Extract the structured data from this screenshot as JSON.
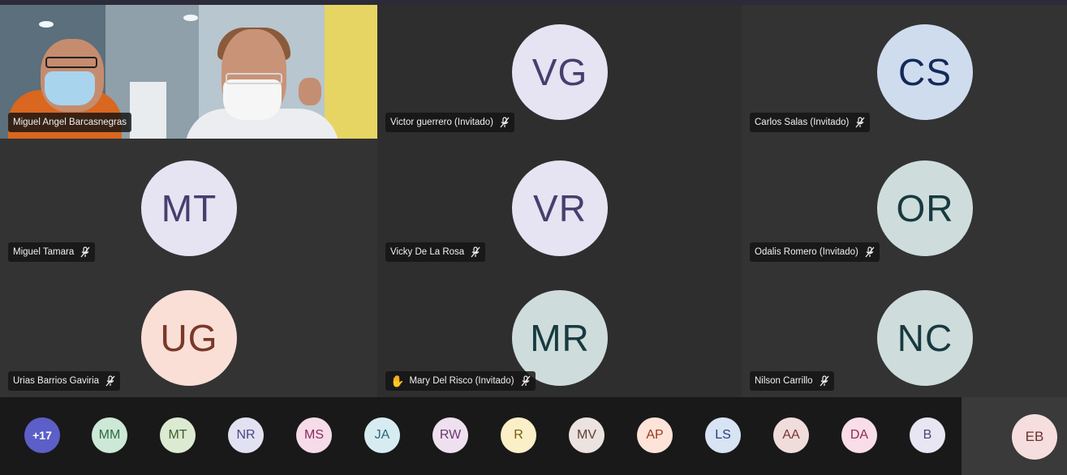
{
  "video_tile": {
    "name": "Miguel Angel Barcasnegras"
  },
  "tiles": [
    {
      "initials": "VG",
      "name": "Victor guerrero (Invitado)",
      "bg": "#e6e3f2",
      "fg": "#463f6e",
      "muted": true,
      "hand": false
    },
    {
      "initials": "CS",
      "name": "Carlos Salas (Invitado)",
      "bg": "#cfdcee",
      "fg": "#13295a",
      "muted": true,
      "hand": false
    },
    {
      "initials": "MT",
      "name": "Miguel Tamara",
      "bg": "#e6e3f2",
      "fg": "#463f6e",
      "muted": true,
      "hand": false
    },
    {
      "initials": "VR",
      "name": "Vicky De La Rosa",
      "bg": "#e6e3f2",
      "fg": "#463f6e",
      "muted": true,
      "hand": false
    },
    {
      "initials": "OR",
      "name": "Odalis Romero (Invitado)",
      "bg": "#cfdcdc",
      "fg": "#173a3f",
      "muted": true,
      "hand": false
    },
    {
      "initials": "UG",
      "name": "Urias Barrios Gaviria",
      "bg": "#fadfd7",
      "fg": "#7a3828",
      "muted": true,
      "hand": false
    },
    {
      "initials": "MR",
      "name": "Mary Del Risco (Invitado)",
      "bg": "#cfdcdc",
      "fg": "#173a3f",
      "muted": true,
      "hand": true
    },
    {
      "initials": "NC",
      "name": "Nilson Carrillo",
      "bg": "#cfdcdc",
      "fg": "#173a3f",
      "muted": true,
      "hand": false
    }
  ],
  "overflow": {
    "label": "+17"
  },
  "strip": [
    {
      "initials": "MM",
      "bg": "#cde8d6",
      "fg": "#2c6b45"
    },
    {
      "initials": "MT",
      "bg": "#dcead2",
      "fg": "#3f5e2c"
    },
    {
      "initials": "NR",
      "bg": "#e2e1f2",
      "fg": "#4a4785"
    },
    {
      "initials": "MS",
      "bg": "#f6dbe8",
      "fg": "#8a2a5e"
    },
    {
      "initials": "JA",
      "bg": "#d6ecf0",
      "fg": "#2a6878"
    },
    {
      "initials": "RW",
      "bg": "#eee0ef",
      "fg": "#6c3a72"
    },
    {
      "initials": "R",
      "bg": "#fbefc8",
      "fg": "#7a5a10"
    },
    {
      "initials": "MV",
      "bg": "#ece2df",
      "fg": "#5e4136"
    },
    {
      "initials": "AP",
      "bg": "#fde3d8",
      "fg": "#9a3a1a"
    },
    {
      "initials": "LS",
      "bg": "#d8e3f3",
      "fg": "#27427a"
    },
    {
      "initials": "AA",
      "bg": "#f1dcdc",
      "fg": "#7a3333"
    },
    {
      "initials": "DA",
      "bg": "#f9dde8",
      "fg": "#8e2d55"
    },
    {
      "initials": "B",
      "bg": "#e8e6f3",
      "fg": "#4a4577"
    }
  ],
  "pinned": {
    "initials": "EB",
    "bg": "#f5dedd",
    "fg": "#6b2d33"
  }
}
